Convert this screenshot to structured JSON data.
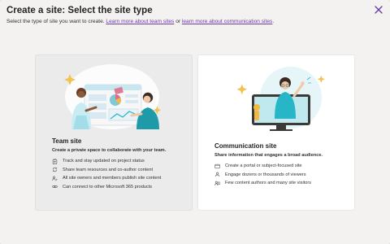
{
  "dialog": {
    "title": "Create a site: Select the site type",
    "subtitle_prefix": "Select the type of site you want to create. ",
    "link_team": "Learn more about team sites",
    "subtitle_or": " or ",
    "link_comm": "learn more about communication sites",
    "subtitle_suffix": "."
  },
  "cards": {
    "team": {
      "title": "Team site",
      "description": "Create a private space to collaborate with your team.",
      "features": [
        "Track and stay updated on project status",
        "Share team resources and co-author content",
        "All site owners and members publish site content",
        "Can connect to other Microsoft 365 products"
      ]
    },
    "communication": {
      "title": "Communication site",
      "description": "Share information that engages a broad audience.",
      "features": [
        "Create a portal or subject-focused site",
        "Engage dozens or thousands of viewers",
        "Few content authors and many site visitors"
      ]
    }
  },
  "icons": {
    "close": "close-icon",
    "team_features": [
      "clipboard-icon",
      "share-refresh-icon",
      "people-edit-icon",
      "link-icon"
    ],
    "comm_features": [
      "web-page-icon",
      "viewers-icon",
      "authors-icon"
    ]
  },
  "colors": {
    "accent": "#6b3aa8",
    "teal": "#27b6c7"
  }
}
